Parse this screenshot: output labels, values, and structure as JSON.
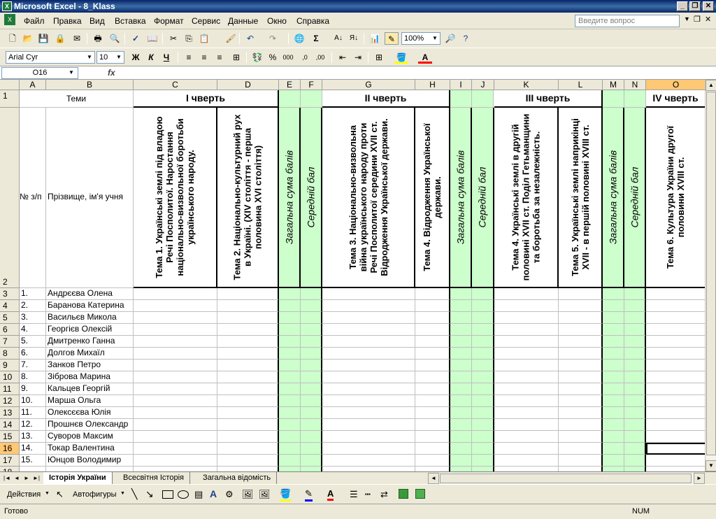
{
  "window": {
    "title": "Microsoft Excel - 8_Klass",
    "minimize": "_",
    "restore": "❐",
    "close": "✕"
  },
  "menu": {
    "items": [
      "Файл",
      "Правка",
      "Вид",
      "Вставка",
      "Формат",
      "Сервис",
      "Данные",
      "Окно",
      "Справка"
    ],
    "ask_placeholder": "Введите вопрос"
  },
  "toolbar": {
    "zoom": "100%",
    "font": "Arial Cyr",
    "size": "10",
    "bold": "Ж",
    "italic": "К",
    "underline": "Ч"
  },
  "formula": {
    "namebox": "O16",
    "fx": "fx",
    "value": ""
  },
  "columns": [
    "A",
    "B",
    "C",
    "D",
    "E",
    "F",
    "G",
    "H",
    "I",
    "J",
    "K",
    "L",
    "M",
    "N",
    "O"
  ],
  "header": {
    "temy": "Теми",
    "q1": "І чверть",
    "q2": "ІІ чверть",
    "q3": "ІІІ чверть",
    "q4": "ІV чверть",
    "num": "№ з/п",
    "name": "Прізвище, ім'я учня",
    "c": "Тема 1. Українські землі під владою Речі Посполитої. Наростання національно-визвольної боротьби українського народу.",
    "d": "Тема 2. Національно-культурний рух в Україні. (XIV століття - перша половина XVI століття)",
    "sum": "Загальна сума балів",
    "avg": "Середній бал",
    "g": "Тема 3. Національно-визвольна війна українського народу проти Речі Посполитої середини XVII ст. Відродження Української держави.",
    "h": "Тема 4. Відродження Української держави.",
    "k": "Тема 4. Українські землі в другій половині XVII ст. Поділ Гетьманщини та боротьба за незалежність.",
    "l": "Тема 5. Українські землі наприкінці XVII - в першій половині XVIII ст.",
    "o": "Тема 6. Культура України другої половини XVIII ст."
  },
  "students": [
    {
      "n": "1.",
      "name": "Андрєєва Олена"
    },
    {
      "n": "2.",
      "name": "Баранова Катерина"
    },
    {
      "n": "3.",
      "name": "Васильєв Микола"
    },
    {
      "n": "4.",
      "name": "Георгієв Олексій"
    },
    {
      "n": "5.",
      "name": "Дмитренко Ганна"
    },
    {
      "n": "6.",
      "name": "Долгов Михаїл"
    },
    {
      "n": "7.",
      "name": "Занков Петро"
    },
    {
      "n": "8.",
      "name": "Зіброва Марина"
    },
    {
      "n": "9.",
      "name": "Кальцев Георгій"
    },
    {
      "n": "10.",
      "name": "Марша Ольга"
    },
    {
      "n": "11.",
      "name": "Олексєєва Юлія"
    },
    {
      "n": "12.",
      "name": "Прошнєв Олександр"
    },
    {
      "n": "13.",
      "name": "Суворов Максим"
    },
    {
      "n": "14.",
      "name": "Токар Валентина"
    },
    {
      "n": "15.",
      "name": "Юнцов Володимир"
    }
  ],
  "sheets": [
    "Історія України",
    "Всесвітня Історія",
    "Загальна відомість"
  ],
  "drawing": {
    "actions": "Действия",
    "autoshapes": "Автофигуры"
  },
  "status": {
    "ready": "Готово",
    "num": "NUM"
  }
}
